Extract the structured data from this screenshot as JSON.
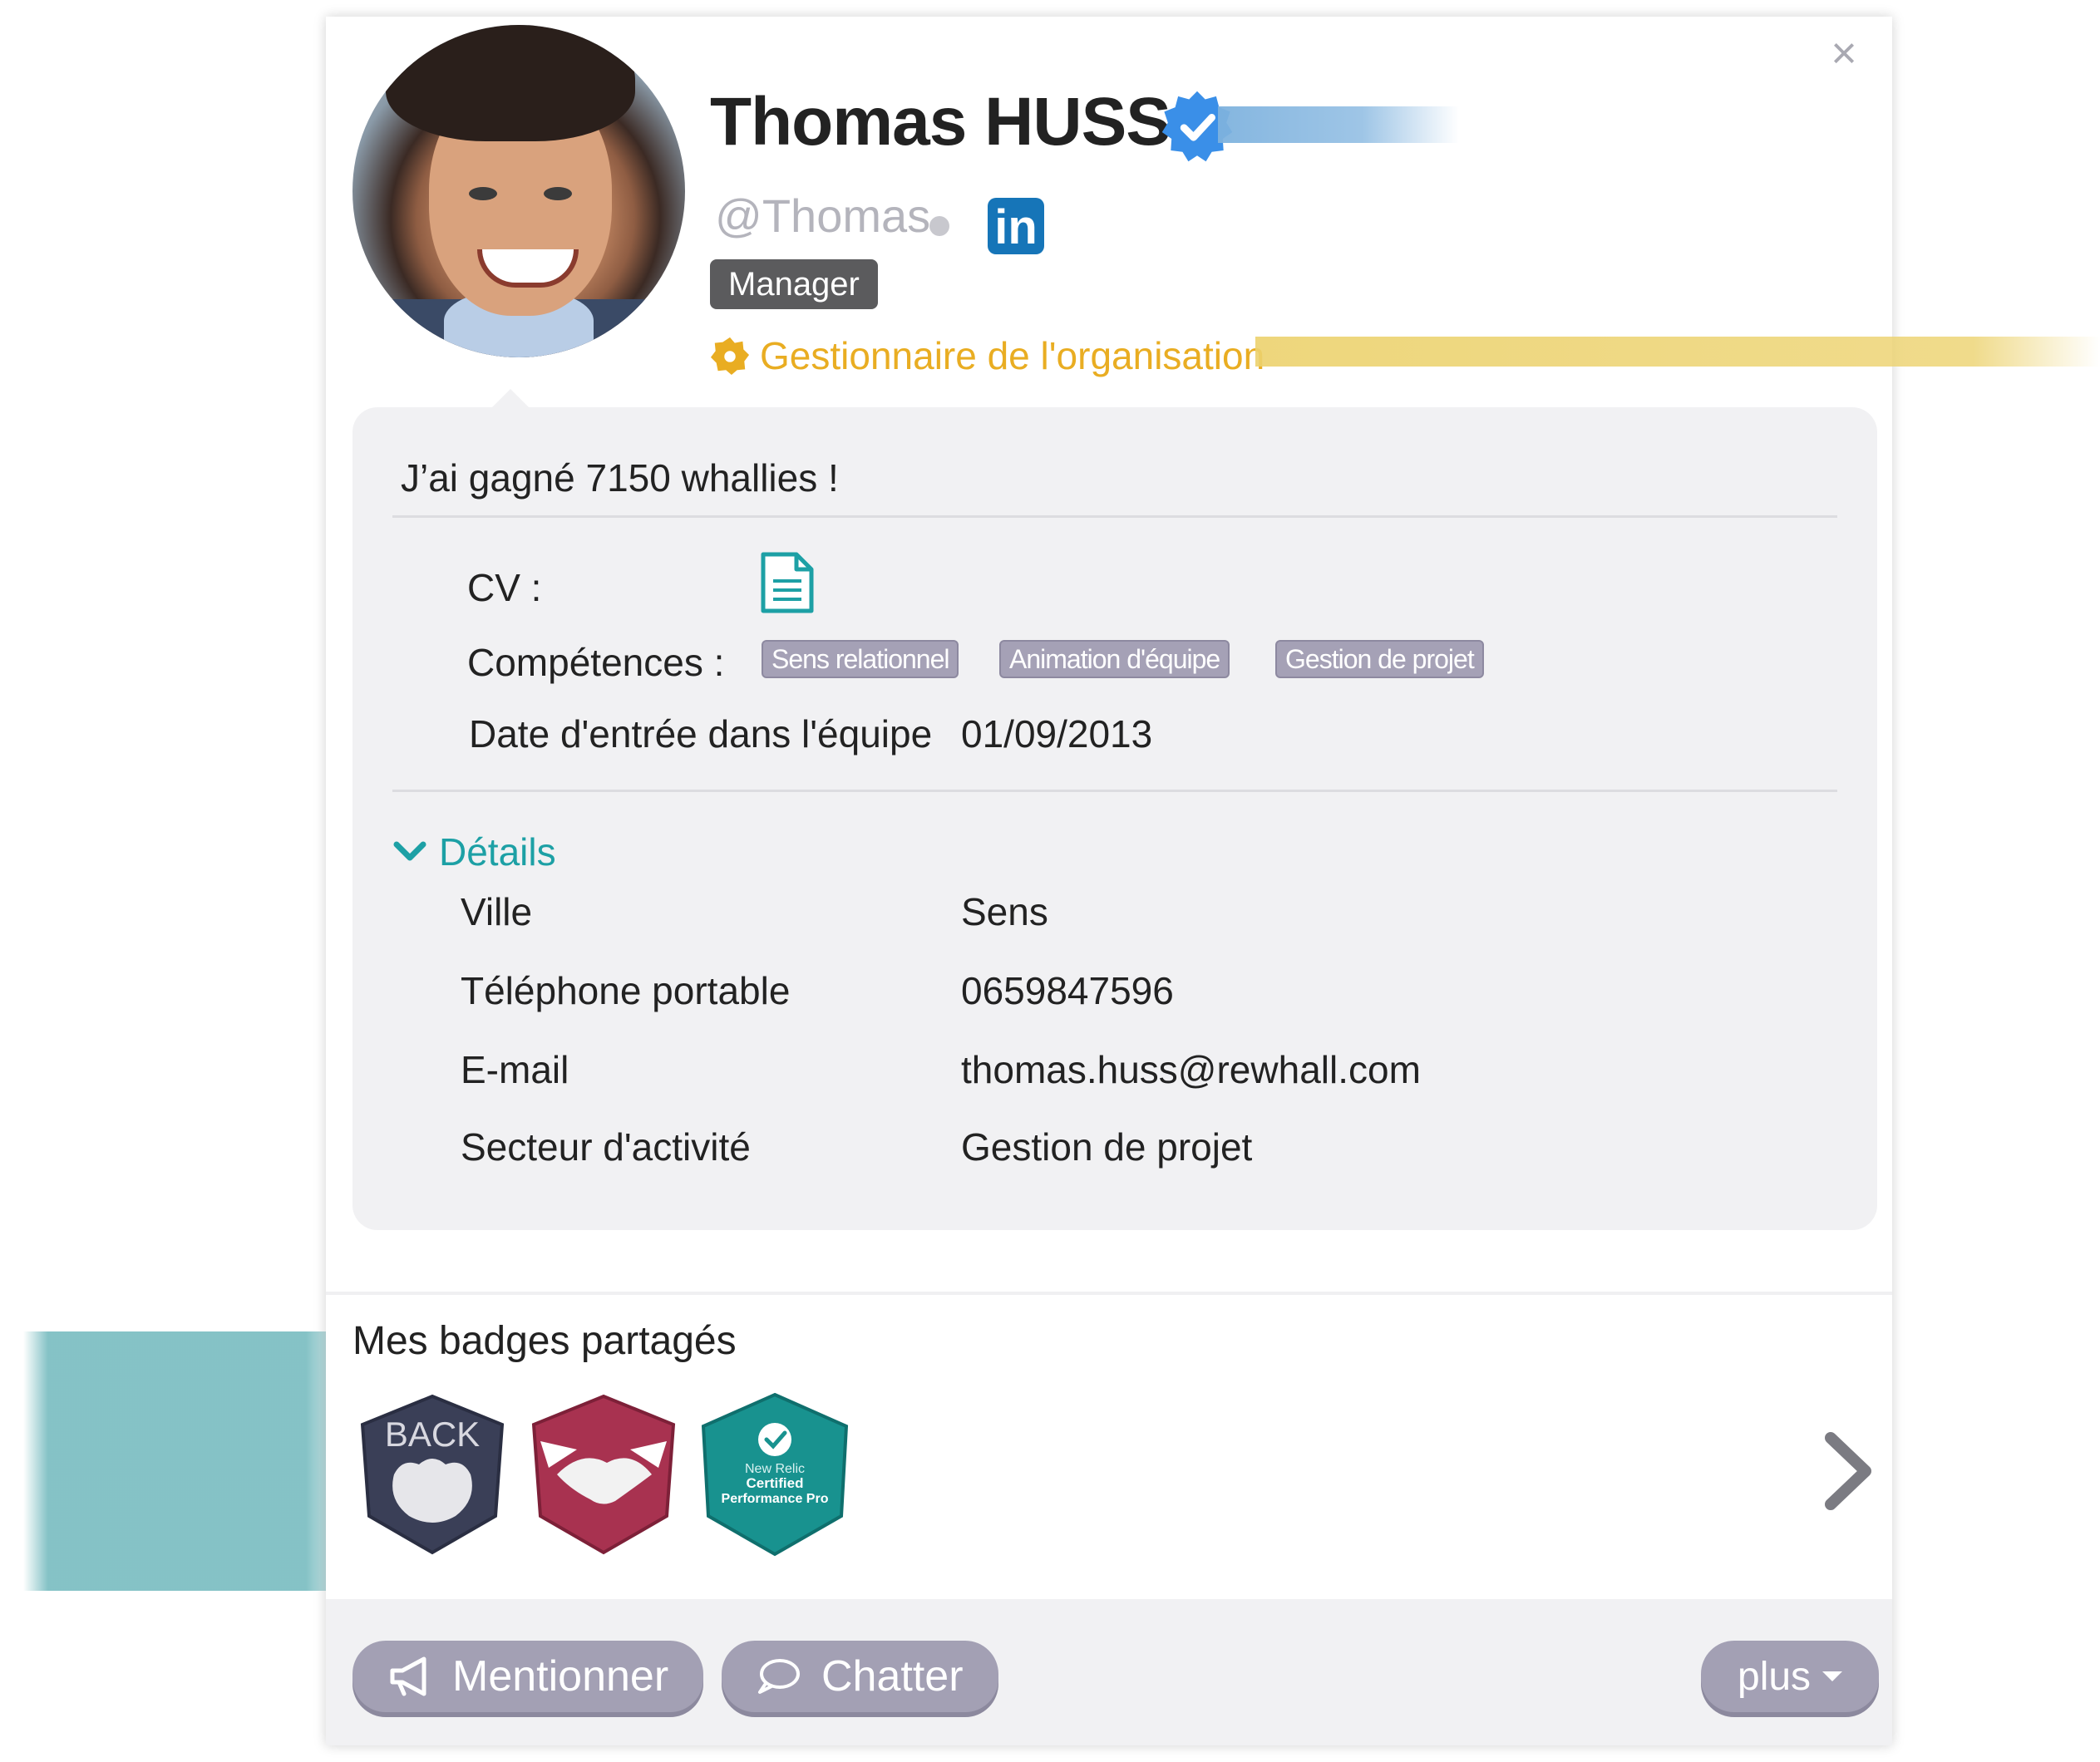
{
  "profile": {
    "name": "Thomas HUSS",
    "handle": "@Thomas",
    "role_badge": "Manager",
    "org_role": "Gestionnaire de l'organisation"
  },
  "info": {
    "whallies_text": "J’ai gagné 7150 whallies !",
    "cv_label": "CV :",
    "skills_label": "Compétences :",
    "skills": [
      "Sens relationnel",
      "Animation d'équipe",
      "Gestion de projet"
    ],
    "start_date_label": "Date d'entrée dans l'équipe",
    "start_date_value": "01/09/2013"
  },
  "details": {
    "toggle_label": "Détails",
    "rows": [
      {
        "label": "Ville",
        "value": "Sens"
      },
      {
        "label": "Téléphone portable",
        "value": "0659847596"
      },
      {
        "label": "E-mail",
        "value": "thomas.huss@rewhall.com"
      },
      {
        "label": "Secteur d'activité",
        "value": "Gestion de projet"
      }
    ]
  },
  "badges": {
    "title": "Mes badges partagés",
    "items": [
      {
        "icon": "back-badge",
        "text": "BACK",
        "color": "#3a3f57"
      },
      {
        "icon": "handshake-badge",
        "color": "#a83250"
      },
      {
        "icon": "new-relic-badge",
        "line1": "New Relic",
        "line2": "Certified",
        "line3": "Performance Pro",
        "color": "#18928f"
      }
    ]
  },
  "footer": {
    "mention_label": "Mentionner",
    "chat_label": "Chatter",
    "more_label": "plus"
  },
  "colors": {
    "accent_teal": "#1da0a5",
    "org_gold": "#e9ad22",
    "button_gray": "#a3a0b4",
    "linkedin_blue": "#1675b8"
  }
}
